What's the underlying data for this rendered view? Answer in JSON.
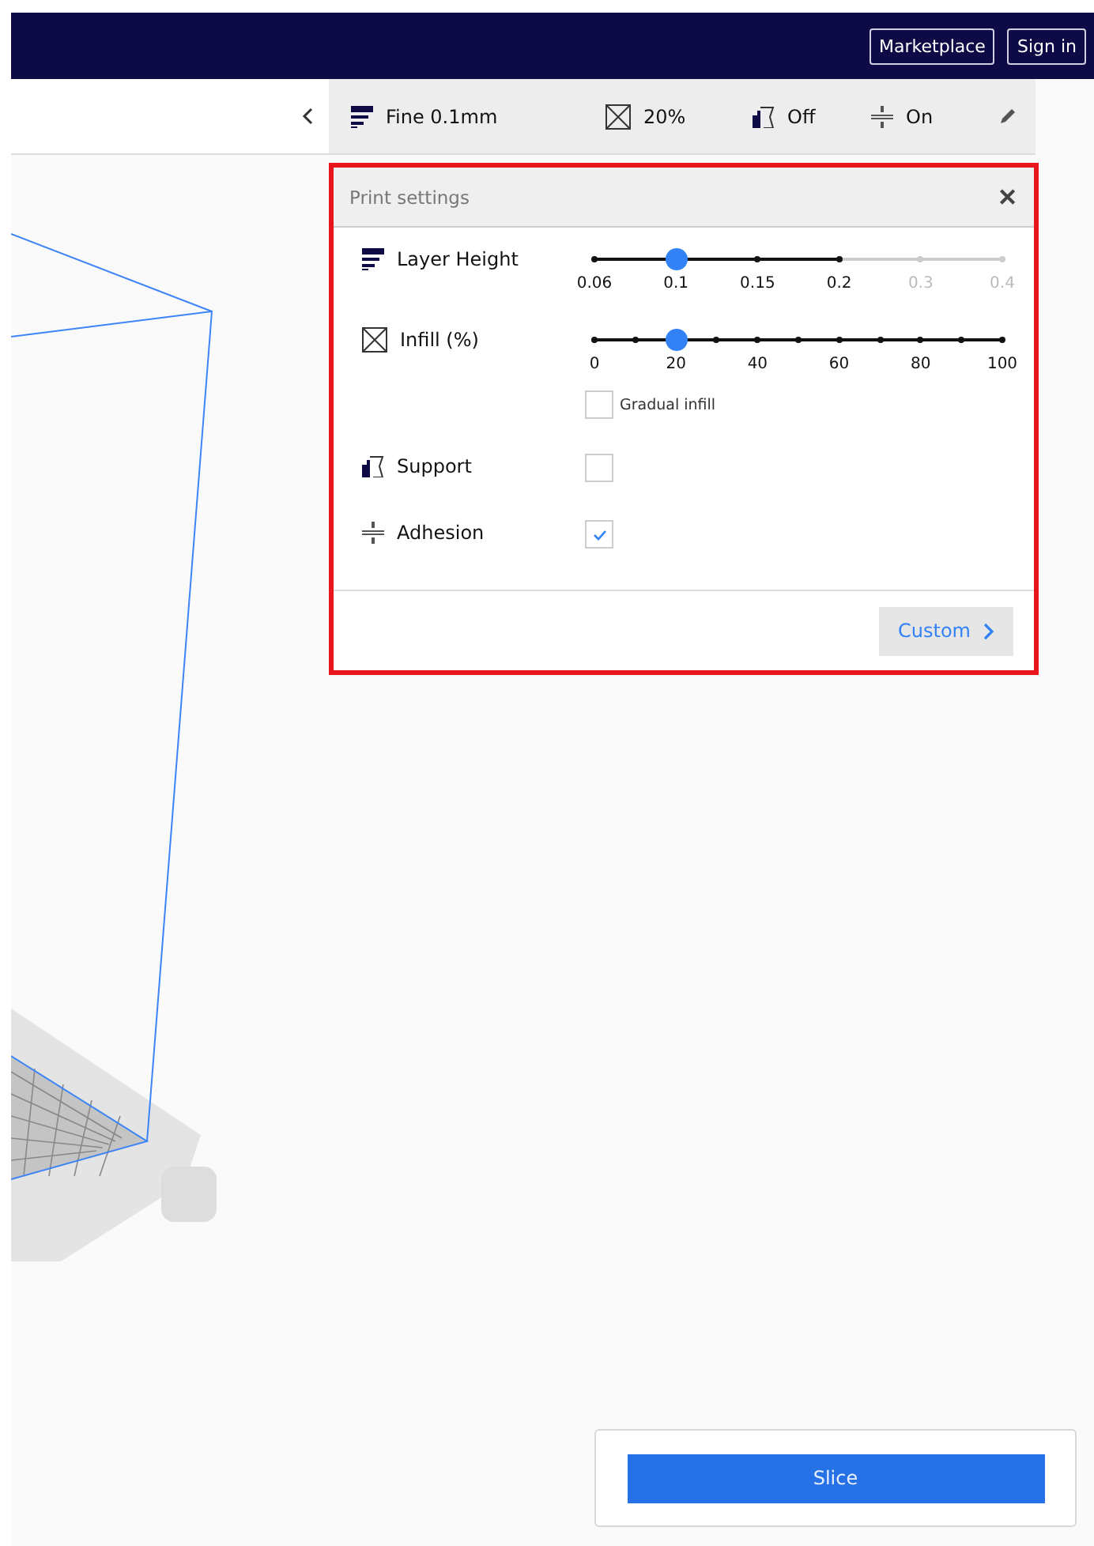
{
  "header": {
    "buttons": [
      {
        "label": "Marketplace"
      },
      {
        "label": "Sign in"
      }
    ]
  },
  "settings_bar": {
    "items": [
      {
        "kind": "layers",
        "label": "Fine 0.1mm"
      },
      {
        "kind": "infill",
        "label": "20%"
      },
      {
        "kind": "support",
        "label": "Off"
      },
      {
        "kind": "adhesion",
        "label": "On"
      }
    ]
  },
  "print_settings": {
    "title": "Print settings",
    "close": "✕",
    "rows": [
      {
        "kind": "slider",
        "label": "Layer Height",
        "level": 0.2,
        "minor_ticks": false,
        "ticks": [
          {
            "label": "0.06",
            "disabled": false
          },
          {
            "label": "0.1",
            "disabled": false
          },
          {
            "label": "0.15",
            "disabled": false
          },
          {
            "label": "0.2",
            "disabled": false
          },
          {
            "label": "0.3",
            "disabled": true
          },
          {
            "label": "0.4",
            "disabled": true
          }
        ]
      },
      {
        "kind": "slider",
        "label": "Infill (%)",
        "level": 0.2,
        "minor_ticks": true,
        "ticks": [
          {
            "label": "0",
            "disabled": false
          },
          {
            "label": "20",
            "disabled": false
          },
          {
            "label": "40",
            "disabled": false
          },
          {
            "label": "60",
            "disabled": false
          },
          {
            "label": "80",
            "disabled": false
          },
          {
            "label": "100",
            "disabled": false
          }
        ],
        "option": {
          "label": "Gradual infill",
          "checked": false
        }
      },
      {
        "kind": "checkbox",
        "label": "Support",
        "checked": false
      },
      {
        "kind": "checkbox",
        "label": "Adhesion",
        "checked": true
      }
    ],
    "custom_button": "Custom"
  },
  "slice_button": "Slice"
}
